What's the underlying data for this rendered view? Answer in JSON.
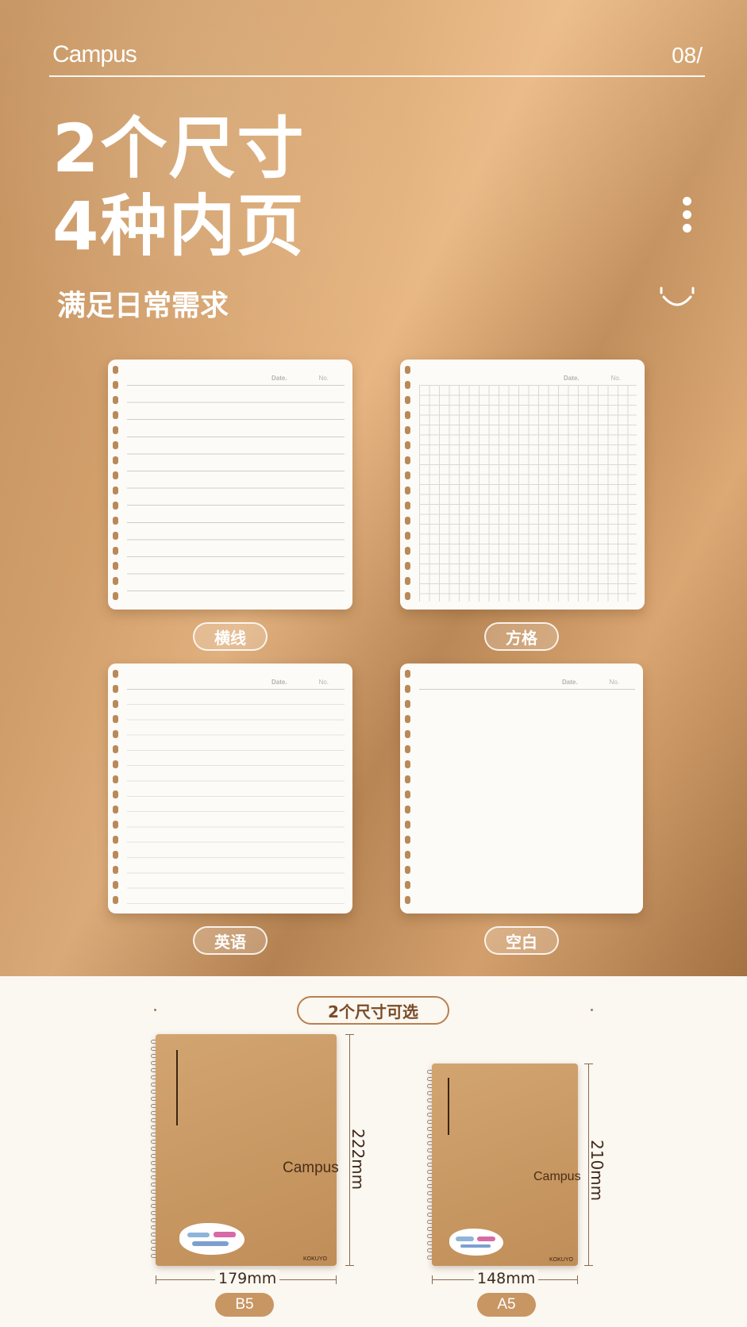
{
  "header": {
    "brand": "Campus",
    "page_number": "08/"
  },
  "headline": {
    "line1": "2个尺寸",
    "line2": "4种内页",
    "subtitle": "满足日常需求"
  },
  "papers": [
    {
      "type": "lined",
      "label": "横线",
      "date_label": "Date.",
      "no_label": "No."
    },
    {
      "type": "grid",
      "label": "方格",
      "date_label": "Date.",
      "no_label": "No."
    },
    {
      "type": "english",
      "label": "英语",
      "date_label": "Date.",
      "no_label": "No."
    },
    {
      "type": "blank",
      "label": "空白",
      "date_label": "Date.",
      "no_label": "No."
    }
  ],
  "sizes": {
    "title": "2个尺寸可选",
    "items": [
      {
        "name": "B5",
        "width": "179mm",
        "height": "222mm",
        "cover_brand": "Campus",
        "cover_maker": "KOKUYO"
      },
      {
        "name": "A5",
        "width": "148mm",
        "height": "210mm",
        "cover_brand": "Campus",
        "cover_maker": "KOKUYO"
      }
    ]
  },
  "colors": {
    "accent": "#c89663",
    "text_dark": "#7a4c27",
    "background": "#fbf7f1"
  }
}
